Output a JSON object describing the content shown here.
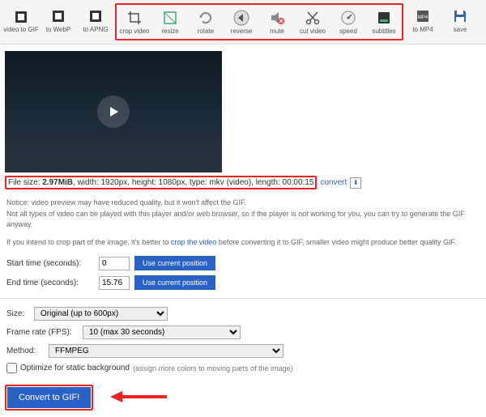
{
  "toolbar": {
    "items": [
      {
        "label": "video to GIF"
      },
      {
        "label": "to WebP"
      },
      {
        "label": "to APNG"
      },
      {
        "label": "crop video"
      },
      {
        "label": "resize"
      },
      {
        "label": "rotate"
      },
      {
        "label": "reverse"
      },
      {
        "label": "mute"
      },
      {
        "label": "cut video"
      },
      {
        "label": "speed"
      },
      {
        "label": "subtitles"
      },
      {
        "label": "to MP4"
      },
      {
        "label": "save"
      }
    ]
  },
  "file_info": {
    "prefix": "File size: ",
    "size": "2.97MiB",
    "rest": ", width: 1920px, height: 1080px, type: mkv (video), length: 00:00:15",
    "convert_label": "convert"
  },
  "notice": {
    "line1": "Notice: video preview may have reduced quality, but it won't affect the GIF.",
    "line2": "Not all types of video can be played with this player and/or web browser, so if the player is not working for you, you can try to generate the GIF anyway.",
    "line3a": "If you intend to crop part of the image, it's better to ",
    "line3link": "crop the video",
    "line3b": " before converting it to GIF, smaller video might produce better quality GIF."
  },
  "time": {
    "start_label": "Start time (seconds):",
    "start_value": "0",
    "end_label": "End time (seconds):",
    "end_value": "15.76",
    "use_pos": "Use current position"
  },
  "opts": {
    "size_label": "Size:",
    "size_value": "Original (up to 600px)",
    "fps_label": "Frame rate (FPS):",
    "fps_value": "10 (max 30 seconds)",
    "method_label": "Method:",
    "method_value": "FFMPEG",
    "opt_label": "Optimize for static background",
    "opt_sub": "(assign more colors to moving parts of the image)"
  },
  "convert_btn": "Convert to GIF!"
}
